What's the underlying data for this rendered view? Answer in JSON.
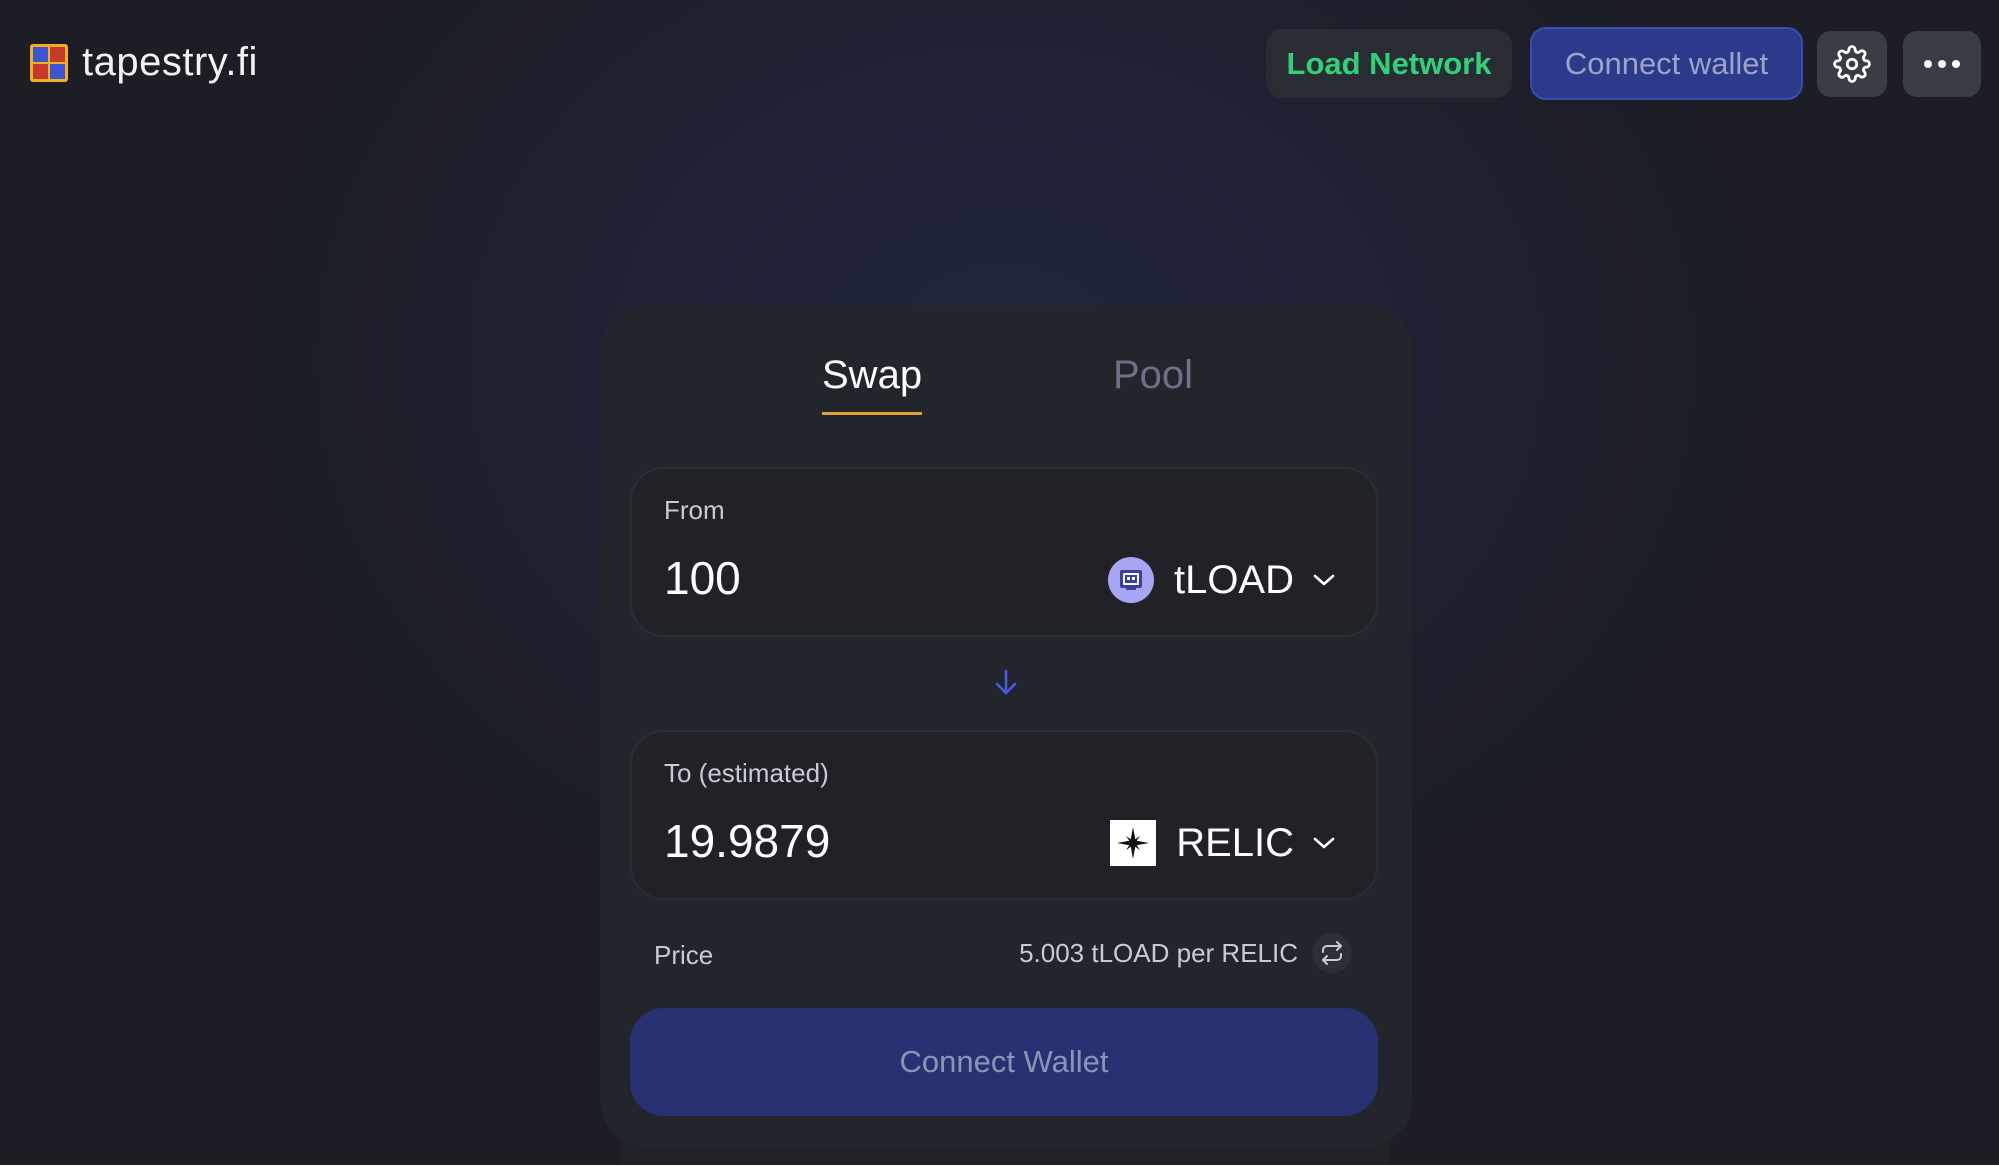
{
  "app": {
    "title": "tapestry.fi"
  },
  "header": {
    "network_label": "Load Network",
    "connect_label": "Connect wallet",
    "settings_icon": "gear-icon",
    "more_icon": "more-horizontal-icon"
  },
  "tabs": [
    {
      "label": "Swap",
      "active": true
    },
    {
      "label": "Pool",
      "active": false
    }
  ],
  "from": {
    "label": "From",
    "amount": "100",
    "token": "tLOAD"
  },
  "to": {
    "label": "To (estimated)",
    "amount": "19.9879",
    "token": "RELIC"
  },
  "price": {
    "label": "Price",
    "value": "5.003 tLOAD per RELIC"
  },
  "action": {
    "label": "Connect Wallet"
  },
  "colors": {
    "network_green": "#2ed27a",
    "accent_blue": "#283272",
    "tab_underline": "#e3a227",
    "arrow_blue": "#4a5ae8"
  }
}
